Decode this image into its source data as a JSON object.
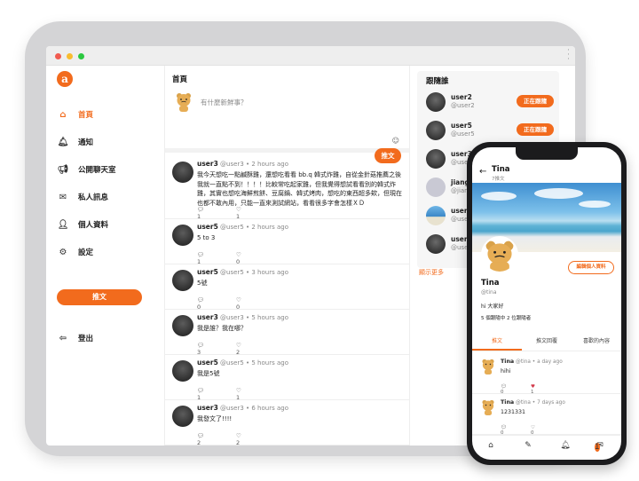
{
  "desktop": {
    "sidebar": {
      "logo": "a",
      "items": [
        {
          "label": "首頁",
          "icon": "home-icon"
        },
        {
          "label": "通知",
          "icon": "bell-icon"
        },
        {
          "label": "公開聊天室",
          "icon": "megaphone-icon"
        },
        {
          "label": "私人訊息",
          "icon": "mail-icon"
        },
        {
          "label": "個人資料",
          "icon": "user-icon"
        },
        {
          "label": "設定",
          "icon": "gear-icon"
        }
      ],
      "tweet_button": "推文",
      "logout": "登出"
    },
    "feed": {
      "title": "首頁",
      "compose_placeholder": "有什麼新鮮事？",
      "compose_button": "推文",
      "posts": [
        {
          "name": "user3",
          "handle": "@user3",
          "time": "2 hours ago",
          "text": "我今天想吃一點鹹酥雞，還想吃看看 bb.q 韓式炸雞，自從金針菇推薦之後我就一直點不到！！！！比較常吃起家雞，但我覺得想試看看別的韓式炸雞，其實也想吃海鮮煎餅、豆腐鍋、韓式烤肉，想吃的東西超多欸，但現在也都不敢內用，只能一直來測試網站，看看很多字會怎樣ＸＤ",
          "replies": "1",
          "likes": "1"
        },
        {
          "name": "user5",
          "handle": "@user5",
          "time": "2 hours ago",
          "text": "5 to 3",
          "replies": "1",
          "likes": "0"
        },
        {
          "name": "user5",
          "handle": "@user5",
          "time": "3 hours ago",
          "text": "5號",
          "replies": "0",
          "likes": "0"
        },
        {
          "name": "user3",
          "handle": "@user3",
          "time": "5 hours ago",
          "text": "我是誰？我在哪？",
          "replies": "3",
          "likes": "2"
        },
        {
          "name": "user5",
          "handle": "@user5",
          "time": "5 hours ago",
          "text": "我是5號",
          "replies": "1",
          "likes": "1"
        },
        {
          "name": "user3",
          "handle": "@user3",
          "time": "6 hours ago",
          "text": "我發文了!!!!",
          "replies": "2",
          "likes": "2"
        }
      ]
    },
    "follow_panel": {
      "title": "跟隨誰",
      "users": [
        {
          "name": "user2",
          "handle": "@user2",
          "button": "正在跟隨"
        },
        {
          "name": "user5",
          "handle": "@user5",
          "button": "正在跟隨"
        },
        {
          "name": "user3",
          "handle": "@user3",
          "button": ""
        },
        {
          "name": "jiang",
          "handle": "@jiang",
          "button": ""
        },
        {
          "name": "user",
          "handle": "@user",
          "button": ""
        },
        {
          "name": "user",
          "handle": "@user",
          "button": ""
        }
      ],
      "show_more": "顯示更多"
    }
  },
  "phone": {
    "header": {
      "name": "Tina",
      "count": "7推文"
    },
    "edit_button": "編輯個人資料",
    "name": "Tina",
    "handle": "@tina",
    "bio": "hi 大家好",
    "stats": "5 個跟隨中   2 位跟隨者",
    "tabs": [
      "推文",
      "推文回覆",
      "喜歡的內容"
    ],
    "posts": [
      {
        "name": "Tina",
        "handle": "@tina",
        "time": "a day ago",
        "text": "hihi",
        "replies": "0",
        "likes": "1"
      },
      {
        "name": "Tina",
        "handle": "@tina",
        "time": "7 days ago",
        "text": "1231331",
        "replies": "0",
        "likes": "0"
      }
    ],
    "notification_badge": "1"
  },
  "colors": {
    "accent": "#f26b1d",
    "frame": "#d4d4d6",
    "phone": "#1b1b1d"
  }
}
